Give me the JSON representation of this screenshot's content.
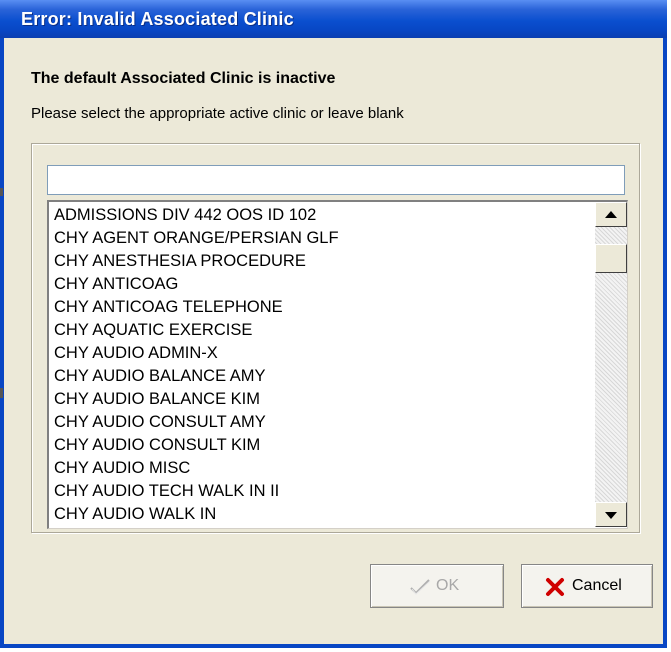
{
  "window": {
    "title": "Error: Invalid Associated Clinic"
  },
  "message": {
    "heading": "The default Associated Clinic is inactive",
    "instruction": "Please select the appropriate active clinic or leave blank"
  },
  "search": {
    "value": ""
  },
  "clinic_list": {
    "items": [
      "ADMISSIONS DIV 442 OOS ID 102",
      "CHY AGENT ORANGE/PERSIAN GLF",
      "CHY ANESTHESIA PROCEDURE",
      "CHY ANTICOAG",
      "CHY ANTICOAG TELEPHONE",
      "CHY AQUATIC EXERCISE",
      "CHY AUDIO ADMIN-X",
      "CHY AUDIO BALANCE AMY",
      "CHY AUDIO BALANCE KIM",
      "CHY AUDIO CONSULT AMY",
      "CHY AUDIO CONSULT KIM",
      "CHY AUDIO MISC",
      "CHY AUDIO TECH WALK IN II",
      "CHY AUDIO WALK IN"
    ]
  },
  "buttons": {
    "ok_label": "OK",
    "ok_enabled": false,
    "cancel_label": "Cancel"
  },
  "icons": {
    "ok": "checkmark-icon",
    "cancel": "red-x-icon",
    "scroll_up": "arrow-up-icon",
    "scroll_down": "arrow-down-icon"
  },
  "colors": {
    "titlebar": "#0A4FCF",
    "dialog_bg": "#ECE9D8",
    "cancel_x": "#D00000",
    "ok_disabled_text": "#A8A8A8"
  }
}
